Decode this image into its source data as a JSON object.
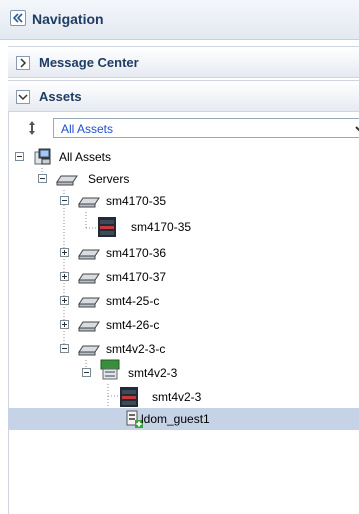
{
  "navigation": {
    "title": "Navigation"
  },
  "accordions": [
    {
      "label": "Message Center",
      "state": "collapsed"
    },
    {
      "label": "Assets",
      "state": "expanded"
    }
  ],
  "filter": {
    "selected": "All Assets"
  },
  "tree": [
    {
      "label": "All Assets",
      "icon": "computer-group-icon",
      "expander": "minus"
    },
    {
      "label": "Servers",
      "icon": "server-folder-icon",
      "expander": "minus"
    },
    {
      "label": "sm4170-35",
      "icon": "server-icon",
      "expander": "minus"
    },
    {
      "label": "sm4170-35",
      "icon": "server-chassis-icon"
    },
    {
      "label": "sm4170-36",
      "icon": "server-icon",
      "expander": "plus"
    },
    {
      "label": "sm4170-37",
      "icon": "server-icon",
      "expander": "plus"
    },
    {
      "label": "smt4-25-c",
      "icon": "server-icon",
      "expander": "plus"
    },
    {
      "label": "smt4-26-c",
      "icon": "server-icon",
      "expander": "plus"
    },
    {
      "label": "smt4v2-3-c",
      "icon": "server-icon",
      "expander": "minus"
    },
    {
      "label": "smt4v2-3",
      "icon": "sparc-os-icon",
      "expander": "minus"
    },
    {
      "label": "smt4v2-3",
      "icon": "server-chassis-icon"
    },
    {
      "label": "ldom_guest1",
      "icon": "ldom-guest-icon",
      "selected": true
    }
  ],
  "colors": {
    "header_text": "#1f3c63",
    "link_blue": "#1f4fd0",
    "selection": "#c6d3e6"
  }
}
